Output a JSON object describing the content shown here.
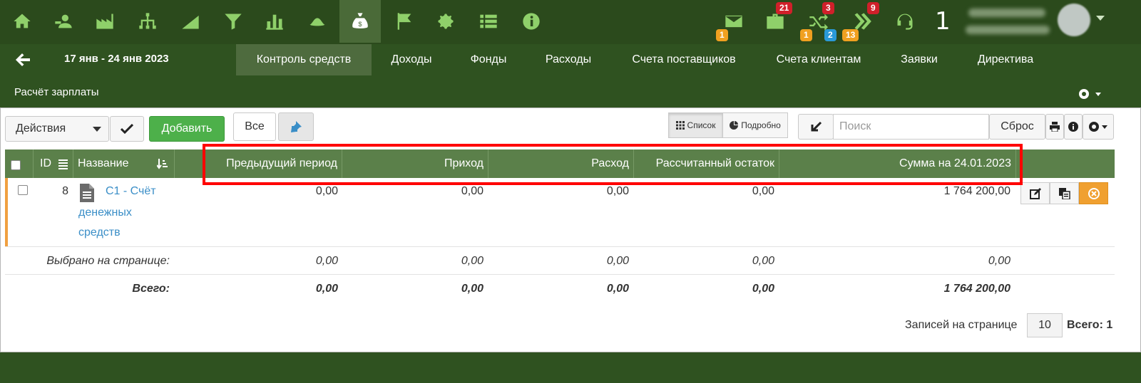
{
  "top_icons": [
    {
      "name": "home-icon"
    },
    {
      "name": "contacts-icon"
    },
    {
      "name": "factory-icon"
    },
    {
      "name": "org-structure-icon"
    },
    {
      "name": "growth-chart-icon"
    },
    {
      "name": "filter-icon"
    },
    {
      "name": "bar-chart-icon"
    },
    {
      "name": "hat-icon"
    },
    {
      "name": "money-bag-icon",
      "active": true
    },
    {
      "name": "flag-icon"
    },
    {
      "name": "gear-icon"
    },
    {
      "name": "list-icon"
    },
    {
      "name": "info-icon"
    }
  ],
  "notifications": {
    "mail_badge": "1",
    "tasks_badge": "21",
    "shuffle_badge_top": "3",
    "shuffle_badge_orange": "1",
    "shuffle_badge_blue": "2",
    "forward_badge_top": "9",
    "forward_badge_orange": "13",
    "count": "1"
  },
  "nav": {
    "date_range": "17 янв - 24 янв 2023",
    "tabs": [
      {
        "label": "Контроль средств",
        "active": true
      },
      {
        "label": "Доходы"
      },
      {
        "label": "Фонды"
      },
      {
        "label": "Расходы"
      },
      {
        "label": "Счета поставщиков"
      },
      {
        "label": "Счета клиентам"
      },
      {
        "label": "Заявки"
      },
      {
        "label": "Директива"
      }
    ]
  },
  "section_title": "Расчёт зарплаты",
  "toolbar": {
    "actions_label": "Действия",
    "add_label": "Добавить",
    "all_label": "Все",
    "view_list": "Список",
    "view_detail": "Подробно",
    "search_placeholder": "Поиск",
    "reset_label": "Сброс"
  },
  "table": {
    "headers": {
      "id": "ID",
      "name": "Название",
      "prev_period": "Предыдущий период",
      "income": "Приход",
      "expense": "Расход",
      "calc_balance": "Рассчитанный остаток",
      "sum_on_date": "Сумма на 24.01.2023"
    },
    "rows": [
      {
        "id": "8",
        "name_line1": "C1 - Счёт",
        "name_line2": "денежных",
        "name_line3": "средств",
        "prev_period": "0,00",
        "income": "0,00",
        "expense": "0,00",
        "calc_balance": "0,00",
        "sum_on_date": "1 764 200,00"
      }
    ],
    "selected": {
      "label": "Выбрано на странице:",
      "prev_period": "0,00",
      "income": "0,00",
      "expense": "0,00",
      "calc_balance": "0,00",
      "sum_on_date": "0,00"
    },
    "total": {
      "label": "Всего:",
      "prev_period": "0,00",
      "income": "0,00",
      "expense": "0,00",
      "calc_balance": "0,00",
      "sum_on_date": "1 764 200,00"
    }
  },
  "pager": {
    "per_page_label": "Записей на странице",
    "per_page_value": "10",
    "total_label": "Всего: 1"
  },
  "colors": {
    "top_bar": "#2b4a1c",
    "header_green": "#5b804a",
    "icon_green": "#8fd06a",
    "highlight_red": "#ff0000"
  }
}
